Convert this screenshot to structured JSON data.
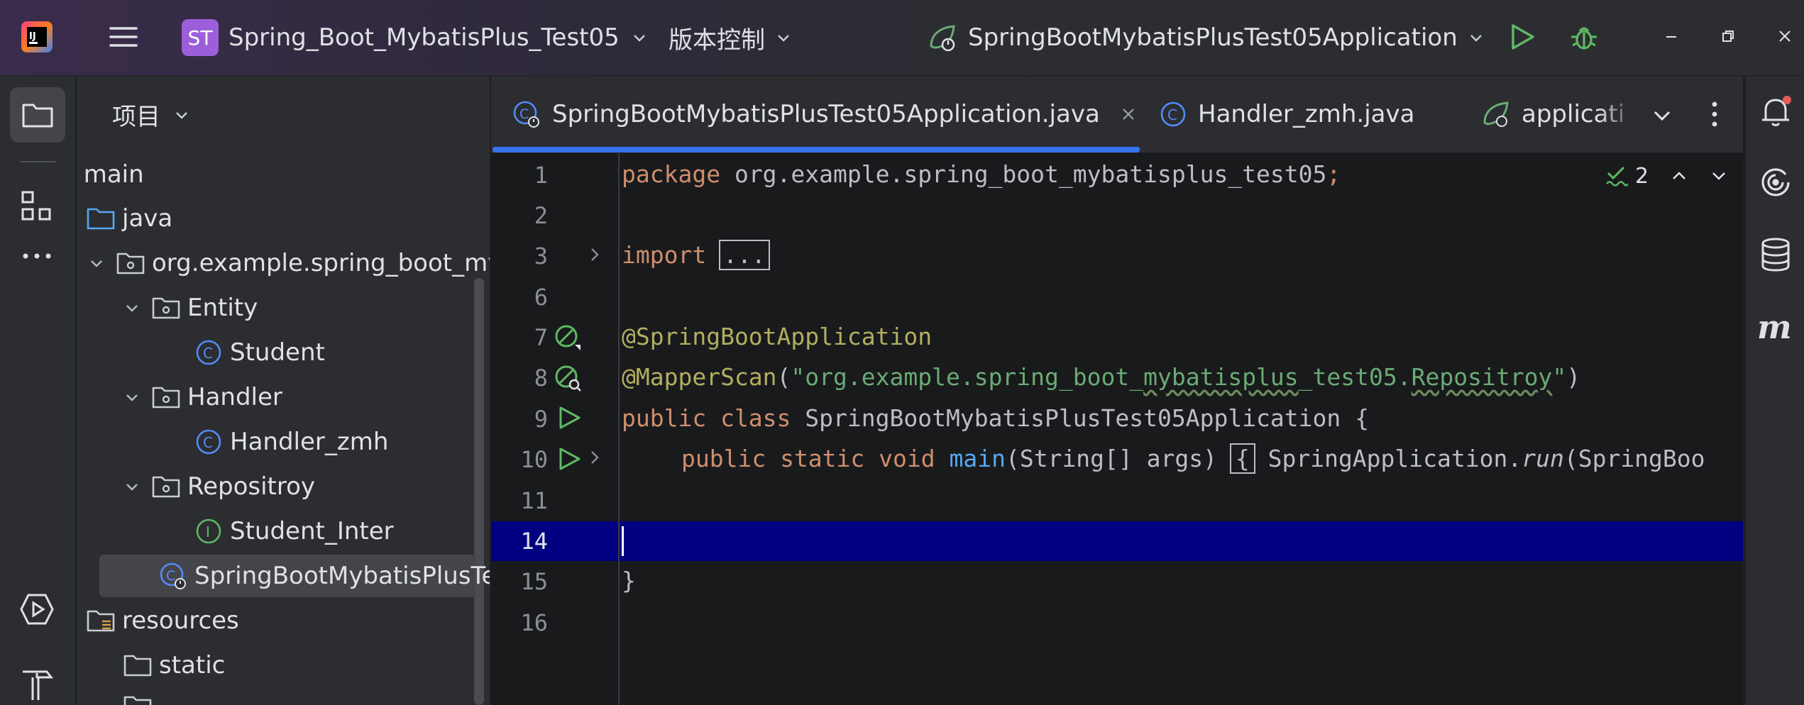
{
  "titlebar": {
    "project_badge": "ST",
    "project_name": "Spring_Boot_MybatisPlus_Test05",
    "vcs": "版本控制",
    "run_config": "SpringBootMybatisPlusTest05Application"
  },
  "project_panel": {
    "title": "项目",
    "tree": [
      {
        "label": "main",
        "type": "folder"
      },
      {
        "label": "java",
        "type": "folder"
      },
      {
        "label": "org.example.spring_boot_mybl",
        "type": "package"
      },
      {
        "label": "Entity",
        "type": "package"
      },
      {
        "label": "Student",
        "type": "class"
      },
      {
        "label": "Handler",
        "type": "package"
      },
      {
        "label": "Handler_zmh",
        "type": "class"
      },
      {
        "label": "Repositroy",
        "type": "package"
      },
      {
        "label": "Student_Inter",
        "type": "interface"
      },
      {
        "label": "SpringBootMybatisPlusTe",
        "type": "app-class",
        "selected": true
      },
      {
        "label": "resources",
        "type": "folder"
      },
      {
        "label": "static",
        "type": "folder"
      }
    ]
  },
  "tabs": [
    {
      "label": "SpringBootMybatisPlusTest05Application.java",
      "active": true
    },
    {
      "label": "Handler_zmh.java",
      "active": false
    },
    {
      "label": "applicati",
      "active": false
    }
  ],
  "inspections": {
    "count": "2"
  },
  "editor": {
    "line_numbers": [
      "1",
      "2",
      "3",
      "6",
      "7",
      "8",
      "9",
      "10",
      "11",
      "14",
      "15",
      "16"
    ],
    "current_line": "14",
    "code": {
      "l1_kw": "package",
      "l1_rest": " org.example.spring_boot_mybatisplus_test05",
      "l1_semi": ";",
      "l3_kw": "import",
      "l3_fold": "...",
      "l7_ann": "@SpringBootApplication",
      "l8_ann": "@MapperScan",
      "l8_open": "(",
      "l8_str_a": "\"org.example.spring_boot_",
      "l8_str_b": "mybatisplus",
      "l8_str_c": "_test05.",
      "l8_str_d": "Repositroy",
      "l8_str_e": "\"",
      "l8_close": ")",
      "l9_kw": "public class",
      "l9_rest": " SpringBootMybatisPlusTest05Application {",
      "l11_kw": "public static void",
      "l11_fn": " main",
      "l11_args": "(String[] args)",
      "l11_brace": "{",
      "l11_call": " SpringApplication.",
      "l11_run": "run",
      "l11_tail": "(SpringBoo",
      "l15": "}"
    }
  },
  "colors": {
    "background": "#1e1f22",
    "panel": "#2b2d30",
    "editor": "#191a1c",
    "accent": "#3574f0",
    "current_line": "#000080",
    "keyword": "#cf8e6d",
    "annotation": "#b3ae60",
    "string": "#6aab73",
    "run_green": "#5fb865"
  }
}
